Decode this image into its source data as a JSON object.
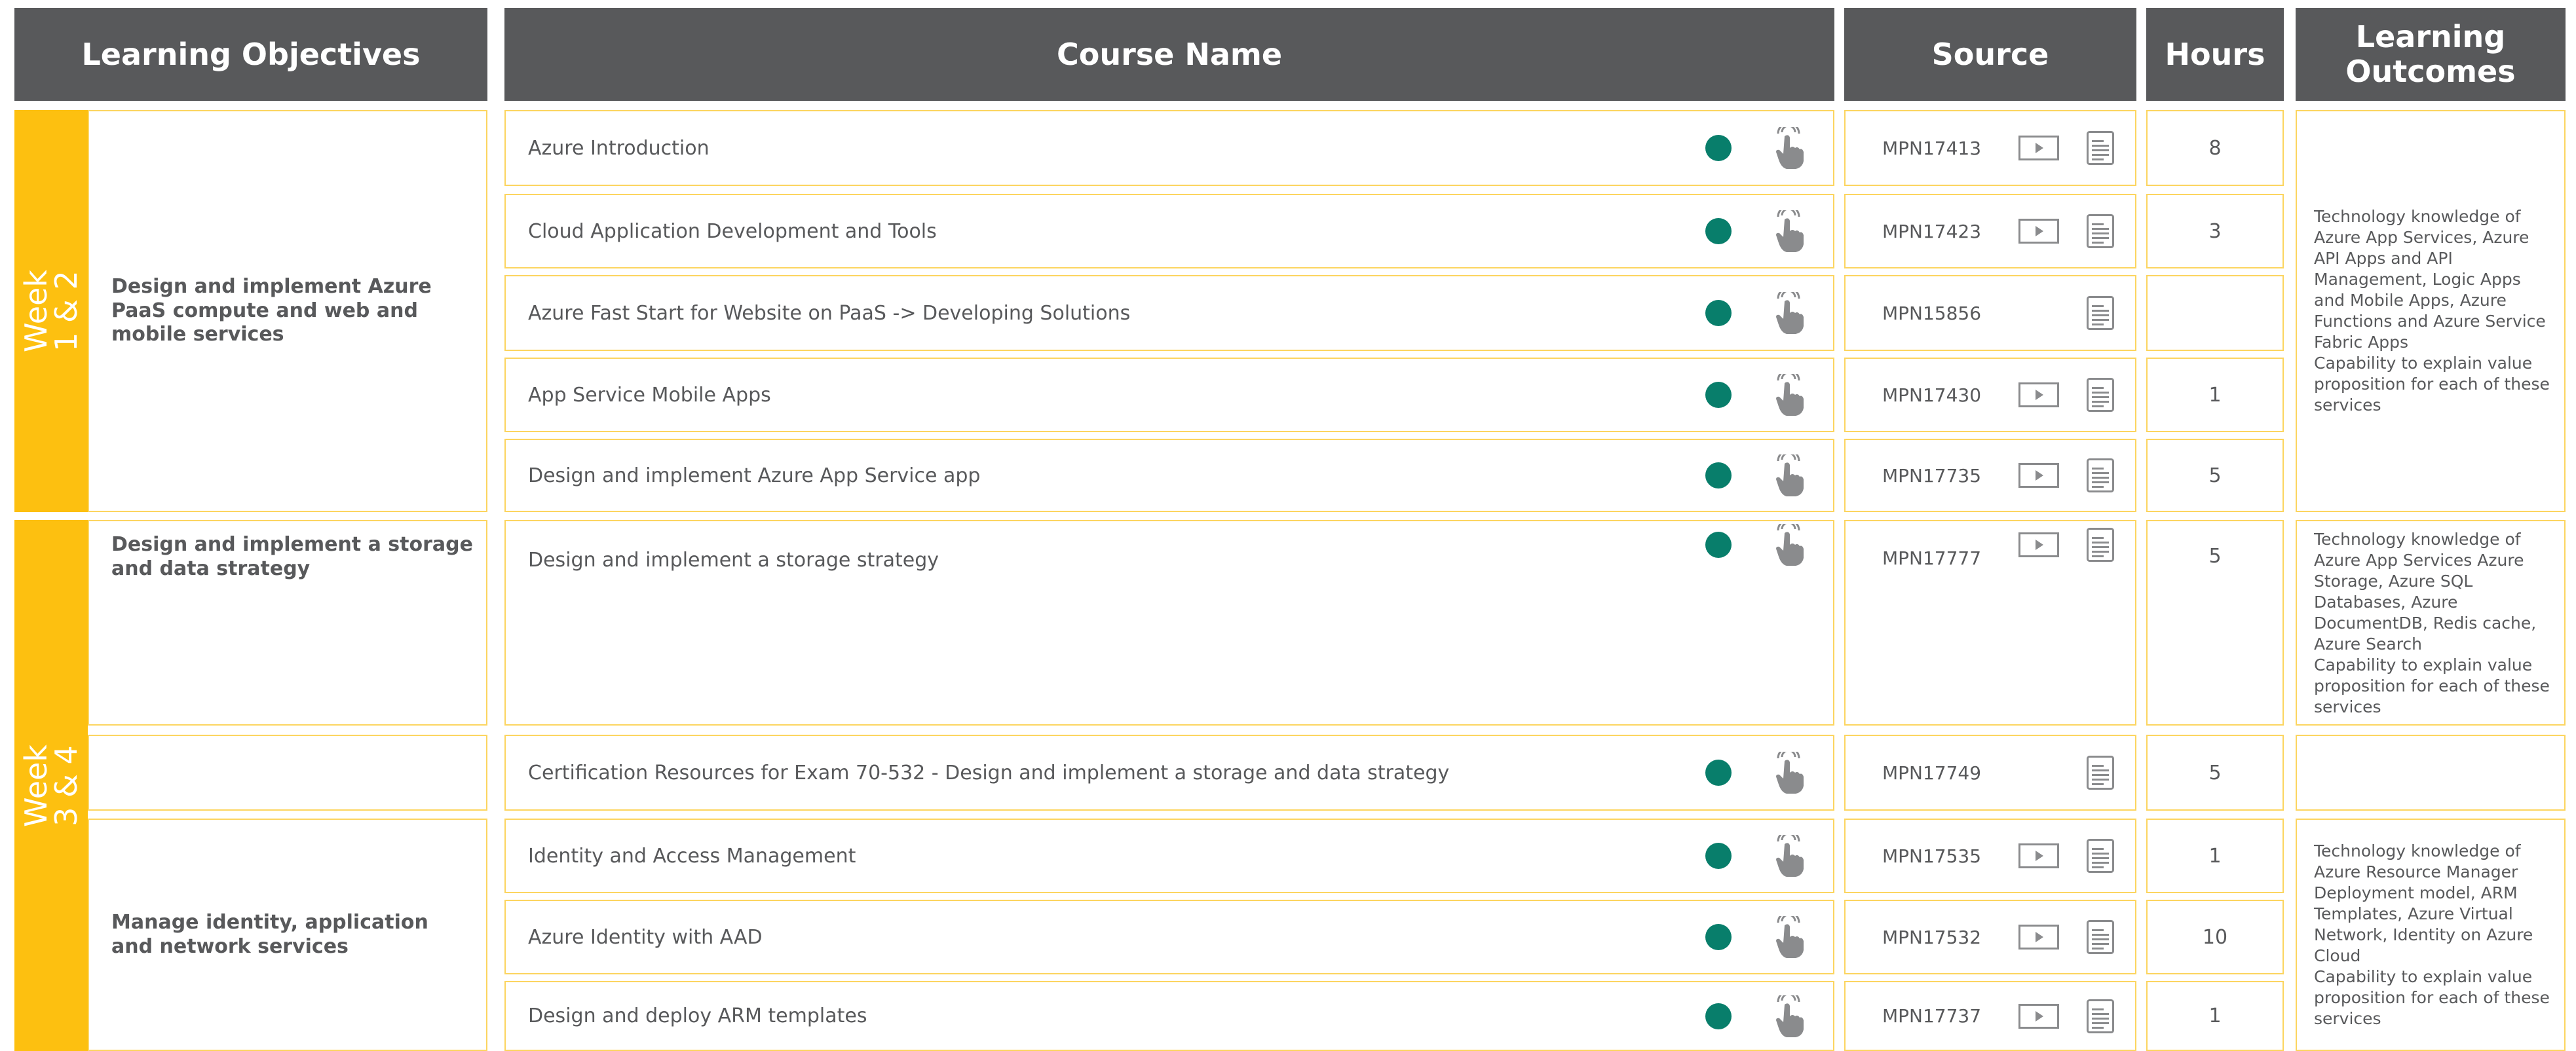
{
  "header": {
    "objectives": "Learning Objectives",
    "course": "Course Name",
    "source": "Source",
    "hours": "Hours",
    "outcomes": "Learning Outcomes"
  },
  "weeks": [
    {
      "label": "Week\n1 & 2"
    },
    {
      "label": "Week\n3 & 4"
    }
  ],
  "objectives": [
    "Design and implement Azure PaaS compute and web and mobile services",
    "Design and implement a storage and data strategy",
    "",
    "Manage identity, application and network services"
  ],
  "rows": [
    {
      "course": "Azure Introduction",
      "source": "MPN17413",
      "hours": "8",
      "video": true
    },
    {
      "course": "Cloud Application Development and Tools",
      "source": "MPN17423",
      "hours": "3",
      "video": true
    },
    {
      "course": "Azure Fast Start for Website on PaaS  -> Developing Solutions",
      "source": "MPN15856",
      "hours": "",
      "video": false
    },
    {
      "course": "App Service Mobile Apps",
      "source": "MPN17430",
      "hours": "1",
      "video": true
    },
    {
      "course": "Design and implement Azure App Service app",
      "source": "MPN17735",
      "hours": "5",
      "video": true
    },
    {
      "course": "Design and implement a storage strategy",
      "source": "MPN17777",
      "hours": "5",
      "video": true
    },
    {
      "course": "Certification Resources for Exam 70-532 - Design and implement a storage and data strategy",
      "source": "MPN17749",
      "hours": "5",
      "video": false
    },
    {
      "course": "Identity and Access Management",
      "source": "MPN17535",
      "hours": "1",
      "video": true
    },
    {
      "course": "Azure Identity with AAD",
      "source": "MPN17532",
      "hours": "10",
      "video": true
    },
    {
      "course": "Design and deploy ARM templates",
      "source": "MPN17737",
      "hours": "1",
      "video": true
    }
  ],
  "outcomes": [
    "Technology knowledge of Azure App Services, Azure API Apps and API Management, Logic Apps and Mobile Apps, Azure Functions and Azure Service Fabric Apps\nCapability to explain value proposition for each of these services",
    "Technology knowledge of Azure App Services Azure Storage, Azure SQL Databases, Azure DocumentDB, Redis cache, Azure Search\nCapability to explain value proposition for each of these services",
    "",
    "Technology knowledge of Azure Resource Manager Deployment model, ARM Templates, Azure Virtual Network, Identity on Azure Cloud\nCapability to explain value proposition for each of these services"
  ],
  "colors": {
    "header_bg": "#58595b",
    "week_bar": "#fdc010",
    "cell_border": "#fcd560",
    "status_dot": "#087e6b",
    "icon_gray": "#8a8b8d"
  },
  "icons": {
    "status": "status-dot-icon",
    "interactive": "touch-hand-icon",
    "video": "video-play-icon",
    "document": "document-icon"
  }
}
